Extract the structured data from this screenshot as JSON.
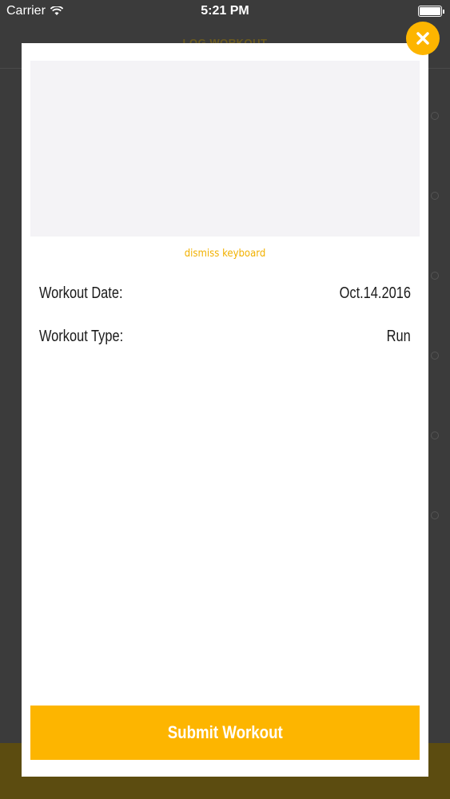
{
  "status_bar": {
    "carrier": "Carrier",
    "time": "5:21 PM"
  },
  "background": {
    "nav_title": "LOG WORKOUT"
  },
  "modal": {
    "text_area_value": "",
    "dismiss_label": "dismiss keyboard",
    "fields": [
      {
        "label": "Workout Date:",
        "value": "Oct.14.2016"
      },
      {
        "label": "Workout Type:",
        "value": "Run"
      }
    ],
    "submit_label": "Submit Workout"
  },
  "colors": {
    "accent": "#fdb500",
    "overlay": "#3b3b3b",
    "text_area": "#f4f3f6"
  },
  "icons": {
    "close": "close-icon",
    "wifi": "wifi-icon",
    "battery": "battery-icon"
  }
}
